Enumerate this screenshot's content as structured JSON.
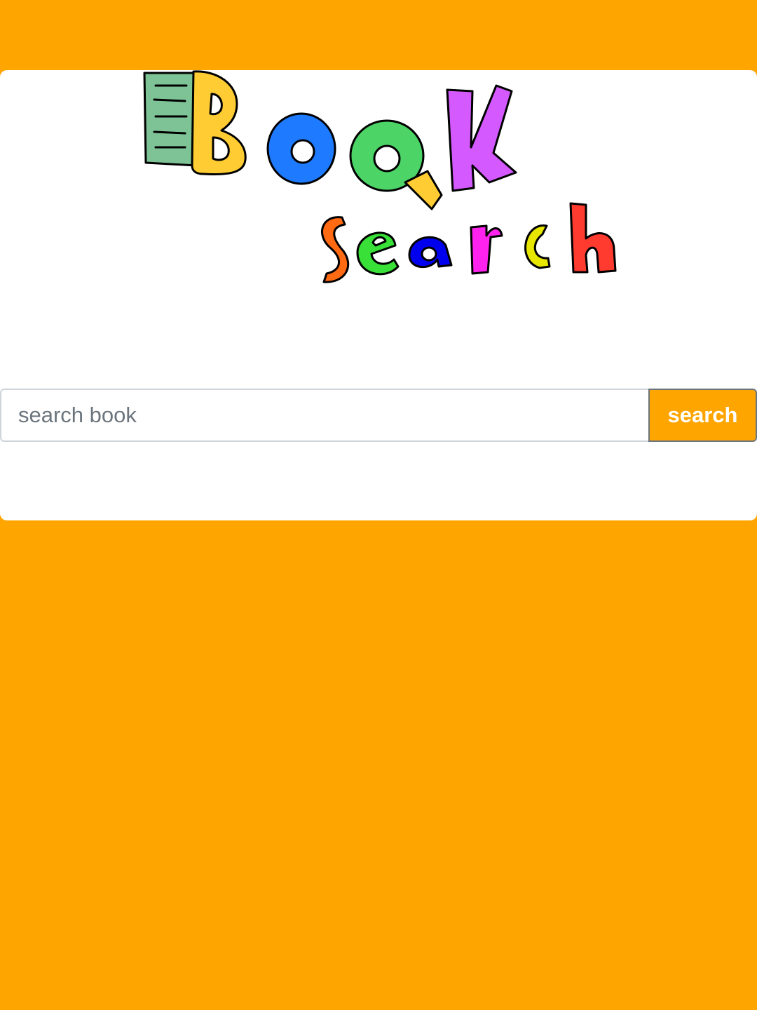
{
  "colors": {
    "background": "#FFA500",
    "card": "#FFFFFF",
    "button": "#FFA500",
    "button_text": "#FFFFFF"
  },
  "logo": {
    "icon": "book-search-logo",
    "word1": "Book",
    "word2": "search"
  },
  "search": {
    "placeholder": "search book",
    "value": "",
    "button_label": "search"
  }
}
